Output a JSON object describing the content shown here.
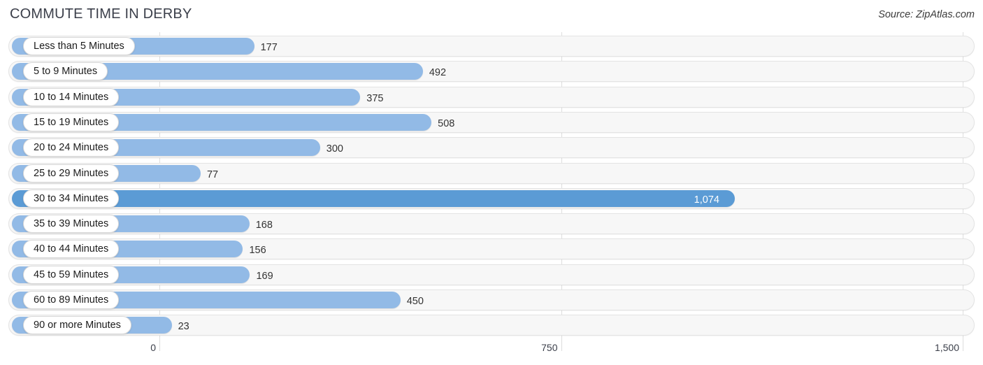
{
  "header": {
    "title": "COMMUTE TIME IN DERBY",
    "source": "Source: ZipAtlas.com"
  },
  "axis": {
    "ticks": [
      "0",
      "750",
      "1,500"
    ],
    "min": 0,
    "max": 1500
  },
  "colors": {
    "bar": "#92bae6",
    "bar_highlight": "#5b9bd5",
    "track": "#f7f7f7",
    "gridline": "#dedede",
    "title": "#3b3f4a",
    "value_text": "#333333",
    "value_text_highlight": "#ffffff"
  },
  "chart_data": {
    "type": "bar",
    "orientation": "horizontal",
    "title": "COMMUTE TIME IN DERBY",
    "subtitle": "",
    "xlabel": "",
    "ylabel": "",
    "xlim": [
      0,
      1500
    ],
    "xticks": [
      0,
      750,
      1500
    ],
    "xticklabels": [
      "0",
      "750",
      "1,500"
    ],
    "grid": true,
    "legend": null,
    "source": "Source: ZipAtlas.com",
    "categories": [
      "Less than 5 Minutes",
      "5 to 9 Minutes",
      "10 to 14 Minutes",
      "15 to 19 Minutes",
      "20 to 24 Minutes",
      "25 to 29 Minutes",
      "30 to 34 Minutes",
      "35 to 39 Minutes",
      "40 to 44 Minutes",
      "45 to 59 Minutes",
      "60 to 89 Minutes",
      "90 or more Minutes"
    ],
    "values": [
      177,
      492,
      375,
      508,
      300,
      77,
      1074,
      168,
      156,
      169,
      450,
      23
    ],
    "value_labels": [
      "177",
      "492",
      "375",
      "508",
      "300",
      "77",
      "1,074",
      "168",
      "156",
      "169",
      "450",
      "23"
    ],
    "highlight_index": 6
  },
  "rows": [
    {
      "label": "Less than 5 Minutes",
      "value": 177,
      "value_label": "177",
      "highlight": false
    },
    {
      "label": "5 to 9 Minutes",
      "value": 492,
      "value_label": "492",
      "highlight": false
    },
    {
      "label": "10 to 14 Minutes",
      "value": 375,
      "value_label": "375",
      "highlight": false
    },
    {
      "label": "15 to 19 Minutes",
      "value": 508,
      "value_label": "508",
      "highlight": false
    },
    {
      "label": "20 to 24 Minutes",
      "value": 300,
      "value_label": "300",
      "highlight": false
    },
    {
      "label": "25 to 29 Minutes",
      "value": 77,
      "value_label": "77",
      "highlight": false
    },
    {
      "label": "30 to 34 Minutes",
      "value": 1074,
      "value_label": "1,074",
      "highlight": true
    },
    {
      "label": "35 to 39 Minutes",
      "value": 168,
      "value_label": "168",
      "highlight": false
    },
    {
      "label": "40 to 44 Minutes",
      "value": 156,
      "value_label": "156",
      "highlight": false
    },
    {
      "label": "45 to 59 Minutes",
      "value": 169,
      "value_label": "169",
      "highlight": false
    },
    {
      "label": "60 to 89 Minutes",
      "value": 450,
      "value_label": "450",
      "highlight": false
    },
    {
      "label": "90 or more Minutes",
      "value": 23,
      "value_label": "23",
      "highlight": false
    }
  ]
}
